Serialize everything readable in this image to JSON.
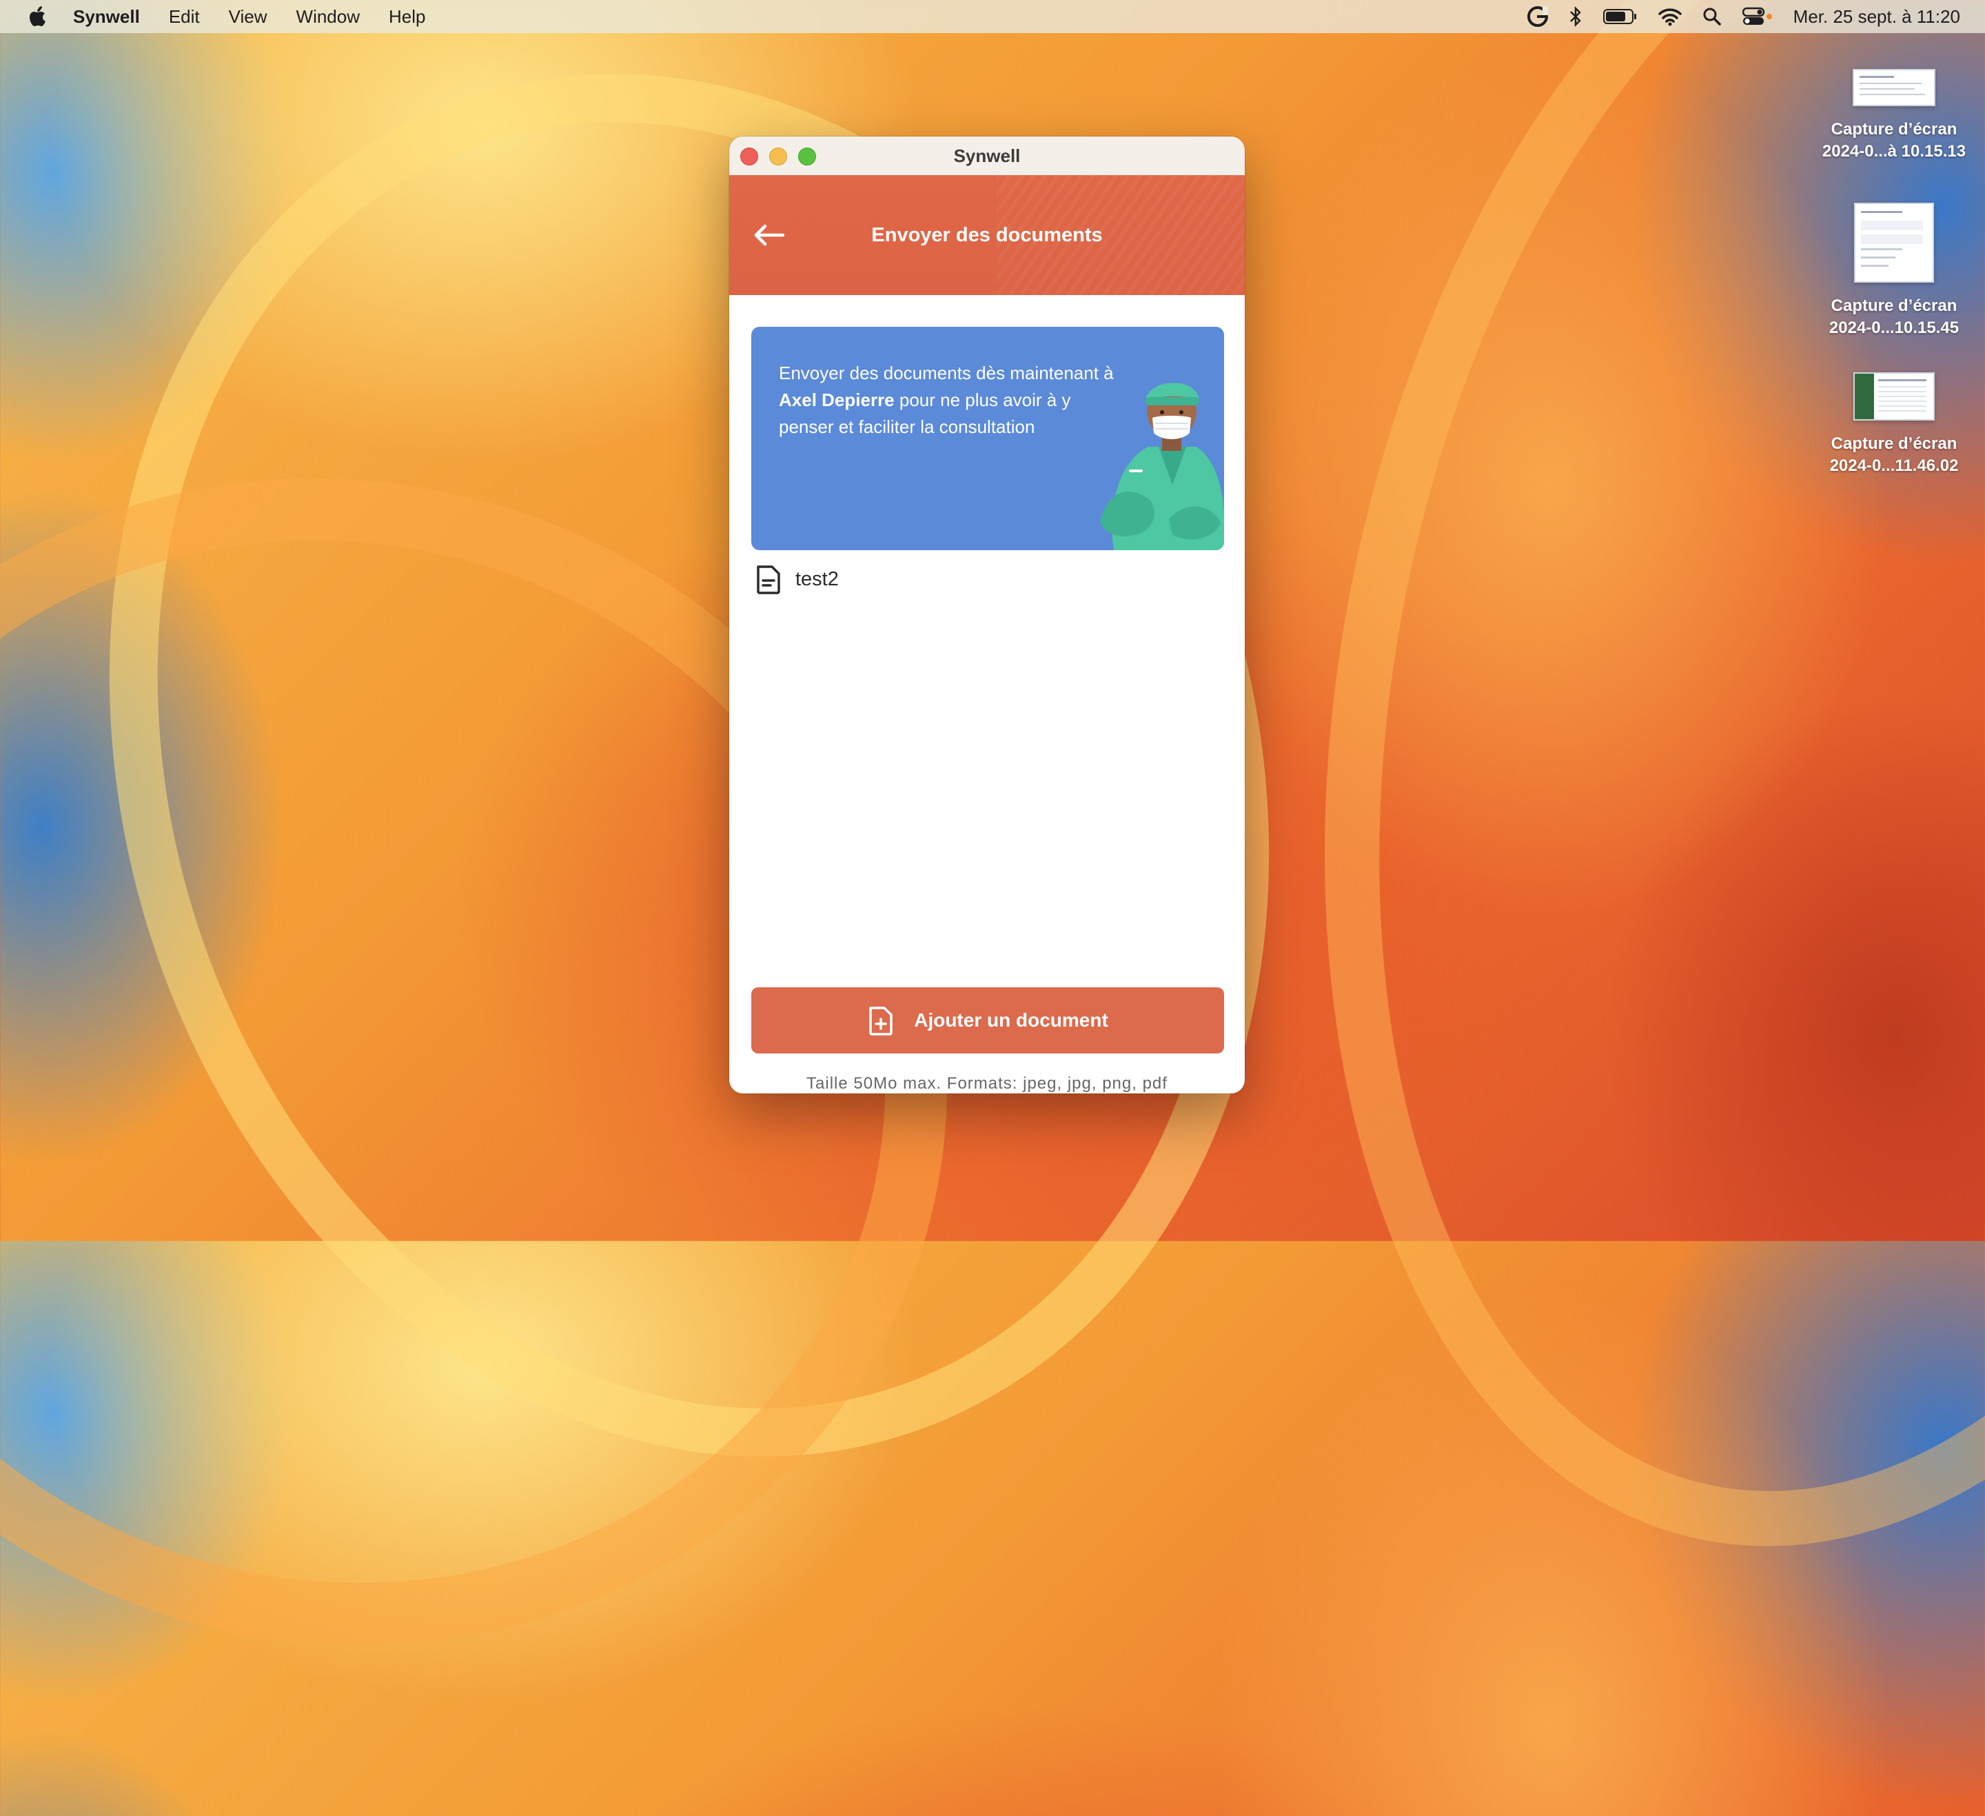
{
  "menubar": {
    "app_name": "Synwell",
    "items": [
      "Edit",
      "View",
      "Window",
      "Help"
    ],
    "clock": "Mer. 25 sept. à 11:20"
  },
  "desktop": {
    "files": [
      {
        "line1": "Capture d’écran",
        "line2": "2024-0...à 10.15.13"
      },
      {
        "line1": "Capture d’écran",
        "line2": "2024-0...10.15.45"
      },
      {
        "line1": "Capture d’écran",
        "line2": "2024-0...11.46.02"
      }
    ]
  },
  "window": {
    "title": "Synwell",
    "header_title": "Envoyer des documents",
    "banner": {
      "text_before": "Envoyer des documents dès maintenant à ",
      "doctor_name": "Axel Depierre",
      "text_after": " pour ne plus avoir à y penser et faciliter la consultation"
    },
    "documents": [
      {
        "name": "test2"
      }
    ],
    "add_button_label": "Ajouter un document",
    "hint": "Taille 50Mo max. Formats: jpeg, jpg, png, pdf"
  },
  "colors": {
    "header": "#dc6446",
    "banner": "#5b8ad8",
    "button": "#dc6a4c"
  }
}
